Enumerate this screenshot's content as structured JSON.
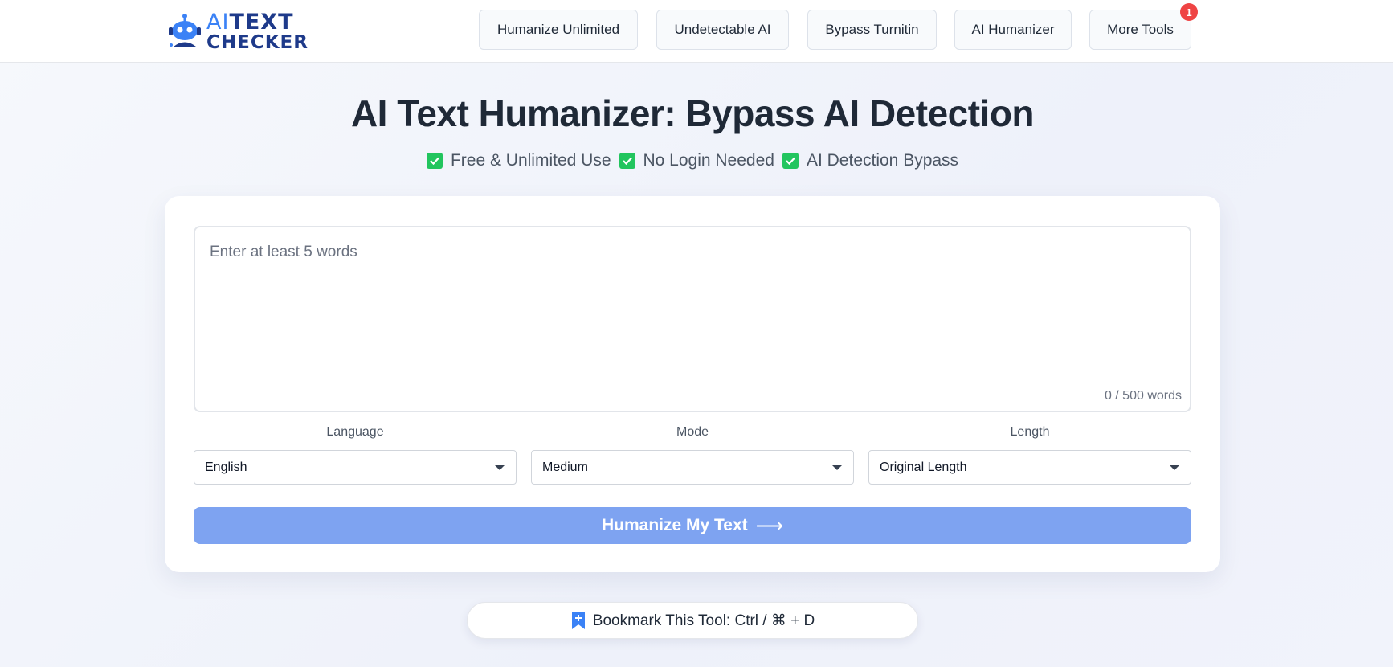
{
  "header": {
    "logo": {
      "line1_accent": "AI",
      "line1_rest": "TEXT",
      "line2": "CHECKER"
    },
    "nav": [
      {
        "label": "Humanize Unlimited"
      },
      {
        "label": "Undetectable AI"
      },
      {
        "label": "Bypass Turnitin"
      },
      {
        "label": "AI Humanizer"
      },
      {
        "label": "More Tools",
        "badge": "1"
      }
    ]
  },
  "hero": {
    "title": "AI Text Humanizer: Bypass AI Detection",
    "features": [
      "Free & Unlimited Use",
      "No Login Needed",
      "AI Detection Bypass"
    ]
  },
  "form": {
    "input": {
      "placeholder": "Enter at least 5 words",
      "value": ""
    },
    "counter": "0 / 500 words",
    "language": {
      "label": "Language",
      "value": "English"
    },
    "mode": {
      "label": "Mode",
      "value": "Medium"
    },
    "length": {
      "label": "Length",
      "value": "Original Length"
    },
    "submit_label": "Humanize My Text",
    "submit_arrow": "⟶"
  },
  "bookmark": {
    "text": "Bookmark This Tool: Ctrl / ⌘ + D"
  },
  "colors": {
    "accent": "#3b82f6",
    "brand_dark": "#1e3a8a",
    "cta": "#7ea3f1",
    "check": "#22c55e",
    "badge": "#ef4444"
  }
}
